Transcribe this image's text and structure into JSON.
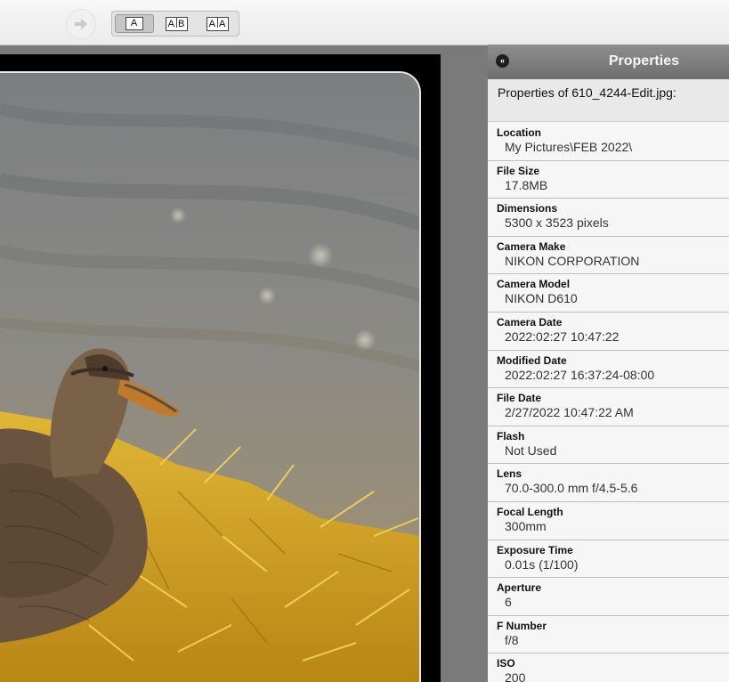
{
  "toolbar": {
    "view_modes": [
      {
        "parts": [
          "A"
        ],
        "active": true
      },
      {
        "parts": [
          "A",
          "B"
        ],
        "active": false
      },
      {
        "parts": [
          "A",
          "A"
        ],
        "active": false
      }
    ]
  },
  "properties_panel": {
    "title": "Properties",
    "heading": "Properties of 610_4244-Edit.jpg:",
    "items": [
      {
        "label": "Location",
        "value": "My Pictures\\FEB 2022\\"
      },
      {
        "label": "File Size",
        "value": "17.8MB"
      },
      {
        "label": "Dimensions",
        "value": "5300 x 3523 pixels"
      },
      {
        "label": "Camera Make",
        "value": "NIKON CORPORATION"
      },
      {
        "label": "Camera Model",
        "value": "NIKON D610"
      },
      {
        "label": "Camera Date",
        "value": "2022:02:27 10:47:22"
      },
      {
        "label": "Modified Date",
        "value": "2022:02:27 16:37:24-08:00"
      },
      {
        "label": "File Date",
        "value": "2/27/2022 10:47:22 AM"
      },
      {
        "label": "Flash",
        "value": "Not Used"
      },
      {
        "label": "Lens",
        "value": "70.0-300.0 mm f/4.5-5.6"
      },
      {
        "label": "Focal Length",
        "value": "300mm"
      },
      {
        "label": "Exposure Time",
        "value": "0.01s (1/100)"
      },
      {
        "label": "Aperture",
        "value": "6"
      },
      {
        "label": "F Number",
        "value": "f/8"
      },
      {
        "label": "ISO",
        "value": "200"
      }
    ]
  },
  "icons": {
    "forward": "arrow-right-icon",
    "collapse": "double-chevron-left-icon"
  },
  "colors": {
    "toolbar_bg": "#eeeeee",
    "panel_header": "#7e7e7e",
    "panel_bg": "#f4f4f4",
    "viewer_bg": "#7a7a7a"
  }
}
